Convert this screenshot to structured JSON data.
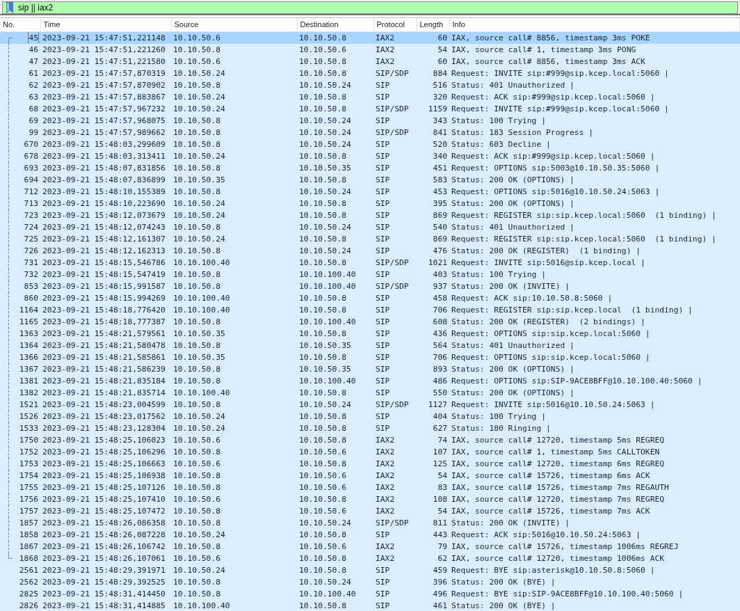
{
  "filter": {
    "value": "sip || iax2"
  },
  "columns": [
    "No.",
    "Time",
    "Source",
    "Destination",
    "Protocol",
    "Length",
    "Info"
  ],
  "rows": [
    {
      "cells": [
        "45",
        "2023-09-21 15:47:51,221148",
        "10.10.50.6",
        "10.10.50.8",
        "IAX2",
        "60",
        "IAX, source call# 8856, timestamp 3ms POKE"
      ],
      "selected": true,
      "kind": "first"
    },
    {
      "cells": [
        "46",
        "2023-09-21 15:47:51,221260",
        "10.10.50.8",
        "10.10.50.6",
        "IAX2",
        "54",
        "IAX, source call# 1, timestamp 3ms PONG"
      ],
      "selected": false,
      "kind": "mid"
    },
    {
      "cells": [
        "47",
        "2023-09-21 15:47:51,221580",
        "10.10.50.6",
        "10.10.50.8",
        "IAX2",
        "60",
        "IAX, source call# 8856, timestamp 3ms ACK"
      ],
      "selected": false,
      "kind": "mid"
    },
    {
      "cells": [
        "61",
        "2023-09-21 15:47:57,870319",
        "10.10.50.24",
        "10.10.50.8",
        "SIP/SDP",
        "884",
        "Request: INVITE sip:#999@sip.kcep.local:5060 |"
      ],
      "selected": false,
      "kind": "mid"
    },
    {
      "cells": [
        "62",
        "2023-09-21 15:47:57,870902",
        "10.10.50.8",
        "10.10.50.24",
        "SIP",
        "516",
        "Status: 401 Unauthorized |"
      ],
      "selected": false,
      "kind": "mid"
    },
    {
      "cells": [
        "63",
        "2023-09-21 15:47:57,883867",
        "10.10.50.24",
        "10.10.50.8",
        "SIP",
        "320",
        "Request: ACK sip:#999@sip.kcep.local:5060 |"
      ],
      "selected": false,
      "kind": "mid"
    },
    {
      "cells": [
        "68",
        "2023-09-21 15:47:57,967232",
        "10.10.50.24",
        "10.10.50.8",
        "SIP/SDP",
        "1159",
        "Request: INVITE sip:#999@sip.kcep.local:5060 |"
      ],
      "selected": false,
      "kind": "mid"
    },
    {
      "cells": [
        "69",
        "2023-09-21 15:47:57,968075",
        "10.10.50.8",
        "10.10.50.24",
        "SIP",
        "343",
        "Status: 100 Trying |"
      ],
      "selected": false,
      "kind": "mid"
    },
    {
      "cells": [
        "99",
        "2023-09-21 15:47:57,989662",
        "10.10.50.8",
        "10.10.50.24",
        "SIP/SDP",
        "841",
        "Status: 183 Session Progress |"
      ],
      "selected": false,
      "kind": "mid"
    },
    {
      "cells": [
        "670",
        "2023-09-21 15:48:03,299609",
        "10.10.50.8",
        "10.10.50.24",
        "SIP",
        "520",
        "Status: 603 Decline |"
      ],
      "selected": false,
      "kind": "mid"
    },
    {
      "cells": [
        "678",
        "2023-09-21 15:48:03,313411",
        "10.10.50.24",
        "10.10.50.8",
        "SIP",
        "340",
        "Request: ACK sip:#999@sip.kcep.local:5060 |"
      ],
      "selected": false,
      "kind": "mid"
    },
    {
      "cells": [
        "693",
        "2023-09-21 15:48:07,831856",
        "10.10.50.8",
        "10.10.50.35",
        "SIP",
        "451",
        "Request: OPTIONS sip:5003@10.10.50.35:5060 |"
      ],
      "selected": false,
      "kind": "mid"
    },
    {
      "cells": [
        "694",
        "2023-09-21 15:48:07,836899",
        "10.10.50.35",
        "10.10.50.8",
        "SIP",
        "583",
        "Status: 200 OK (OPTIONS) |"
      ],
      "selected": false,
      "kind": "mid"
    },
    {
      "cells": [
        "712",
        "2023-09-21 15:48:10,155389",
        "10.10.50.8",
        "10.10.50.24",
        "SIP",
        "453",
        "Request: OPTIONS sip:5016@10.10.50.24:5063 |"
      ],
      "selected": false,
      "kind": "mid"
    },
    {
      "cells": [
        "713",
        "2023-09-21 15:48:10,223690",
        "10.10.50.24",
        "10.10.50.8",
        "SIP",
        "395",
        "Status: 200 OK (OPTIONS) |"
      ],
      "selected": false,
      "kind": "mid"
    },
    {
      "cells": [
        "723",
        "2023-09-21 15:48:12,073679",
        "10.10.50.24",
        "10.10.50.8",
        "SIP",
        "869",
        "Request: REGISTER sip:sip.kcep.local:5060  (1 binding) |"
      ],
      "selected": false,
      "kind": "mid"
    },
    {
      "cells": [
        "724",
        "2023-09-21 15:48:12,074243",
        "10.10.50.8",
        "10.10.50.24",
        "SIP",
        "540",
        "Status: 401 Unauthorized |"
      ],
      "selected": false,
      "kind": "mid"
    },
    {
      "cells": [
        "725",
        "2023-09-21 15:48:12,161307",
        "10.10.50.24",
        "10.10.50.8",
        "SIP",
        "869",
        "Request: REGISTER sip:sip.kcep.local:5060  (1 binding) |"
      ],
      "selected": false,
      "kind": "mid"
    },
    {
      "cells": [
        "726",
        "2023-09-21 15:48:12,162313",
        "10.10.50.8",
        "10.10.50.24",
        "SIP",
        "476",
        "Status: 200 OK (REGISTER)  (1 binding) |"
      ],
      "selected": false,
      "kind": "mid"
    },
    {
      "cells": [
        "731",
        "2023-09-21 15:48:15,546786",
        "10.10.100.40",
        "10.10.50.8",
        "SIP/SDP",
        "1021",
        "Request: INVITE sip:5016@sip.kcep.local |"
      ],
      "selected": false,
      "kind": "mid"
    },
    {
      "cells": [
        "732",
        "2023-09-21 15:48:15,547419",
        "10.10.50.8",
        "10.10.100.40",
        "SIP",
        "403",
        "Status: 100 Trying |"
      ],
      "selected": false,
      "kind": "mid"
    },
    {
      "cells": [
        "853",
        "2023-09-21 15:48:15,991587",
        "10.10.50.8",
        "10.10.100.40",
        "SIP/SDP",
        "937",
        "Status: 200 OK (INVITE) |"
      ],
      "selected": false,
      "kind": "mid"
    },
    {
      "cells": [
        "860",
        "2023-09-21 15:48:15,994269",
        "10.10.100.40",
        "10.10.50.8",
        "SIP",
        "458",
        "Request: ACK sip:10.10.50.8:5060 |"
      ],
      "selected": false,
      "kind": "mid"
    },
    {
      "cells": [
        "1164",
        "2023-09-21 15:48:18,776420",
        "10.10.100.40",
        "10.10.50.8",
        "SIP",
        "706",
        "Request: REGISTER sip:sip.kcep.local  (1 binding) |"
      ],
      "selected": false,
      "kind": "mid"
    },
    {
      "cells": [
        "1165",
        "2023-09-21 15:48:18,777387",
        "10.10.50.8",
        "10.10.100.40",
        "SIP",
        "608",
        "Status: 200 OK (REGISTER)  (2 bindings) |"
      ],
      "selected": false,
      "kind": "mid"
    },
    {
      "cells": [
        "1363",
        "2023-09-21 15:48:21,579561",
        "10.10.50.35",
        "10.10.50.8",
        "SIP",
        "436",
        "Request: OPTIONS sip:sip.kcep.local:5060 |"
      ],
      "selected": false,
      "kind": "mid"
    },
    {
      "cells": [
        "1364",
        "2023-09-21 15:48:21,580478",
        "10.10.50.8",
        "10.10.50.35",
        "SIP",
        "564",
        "Status: 401 Unauthorized |"
      ],
      "selected": false,
      "kind": "mid"
    },
    {
      "cells": [
        "1366",
        "2023-09-21 15:48:21,585861",
        "10.10.50.35",
        "10.10.50.8",
        "SIP",
        "706",
        "Request: OPTIONS sip:sip.kcep.local:5060 |"
      ],
      "selected": false,
      "kind": "mid"
    },
    {
      "cells": [
        "1367",
        "2023-09-21 15:48:21,586239",
        "10.10.50.8",
        "10.10.50.35",
        "SIP",
        "893",
        "Status: 200 OK (OPTIONS) |"
      ],
      "selected": false,
      "kind": "mid"
    },
    {
      "cells": [
        "1381",
        "2023-09-21 15:48:21,835184",
        "10.10.50.8",
        "10.10.100.40",
        "SIP",
        "486",
        "Request: OPTIONS sip:SIP-9ACE8BFF@10.10.100.40:5060 |"
      ],
      "selected": false,
      "kind": "mid"
    },
    {
      "cells": [
        "1382",
        "2023-09-21 15:48:21,835714",
        "10.10.100.40",
        "10.10.50.8",
        "SIP",
        "550",
        "Status: 200 OK (OPTIONS) |"
      ],
      "selected": false,
      "kind": "mid"
    },
    {
      "cells": [
        "1521",
        "2023-09-21 15:48:23,004599",
        "10.10.50.8",
        "10.10.50.24",
        "SIP/SDP",
        "1127",
        "Request: INVITE sip:5016@10.10.50.24:5063 |"
      ],
      "selected": false,
      "kind": "mid"
    },
    {
      "cells": [
        "1526",
        "2023-09-21 15:48:23,017562",
        "10.10.50.24",
        "10.10.50.8",
        "SIP",
        "404",
        "Status: 100 Trying |"
      ],
      "selected": false,
      "kind": "mid"
    },
    {
      "cells": [
        "1533",
        "2023-09-21 15:48:23,128304",
        "10.10.50.24",
        "10.10.50.8",
        "SIP",
        "627",
        "Status: 180 Ringing |"
      ],
      "selected": false,
      "kind": "mid"
    },
    {
      "cells": [
        "1750",
        "2023-09-21 15:48:25,106023",
        "10.10.50.6",
        "10.10.50.8",
        "IAX2",
        "74",
        "IAX, source call# 12720, timestamp 5ms REGREQ"
      ],
      "selected": false,
      "kind": "mid"
    },
    {
      "cells": [
        "1752",
        "2023-09-21 15:48:25,106296",
        "10.10.50.8",
        "10.10.50.6",
        "IAX2",
        "107",
        "IAX, source call# 1, timestamp 5ms CALLTOKEN"
      ],
      "selected": false,
      "kind": "mid"
    },
    {
      "cells": [
        "1753",
        "2023-09-21 15:48:25,106663",
        "10.10.50.6",
        "10.10.50.8",
        "IAX2",
        "125",
        "IAX, source call# 12720, timestamp 6ms REGREQ"
      ],
      "selected": false,
      "kind": "mid"
    },
    {
      "cells": [
        "1754",
        "2023-09-21 15:48:25,106938",
        "10.10.50.8",
        "10.10.50.6",
        "IAX2",
        "54",
        "IAX, source call# 15726, timestamp 6ms ACK"
      ],
      "selected": false,
      "kind": "mid"
    },
    {
      "cells": [
        "1755",
        "2023-09-21 15:48:25,107126",
        "10.10.50.8",
        "10.10.50.6",
        "IAX2",
        "83",
        "IAX, source call# 15726, timestamp 7ms REGAUTH"
      ],
      "selected": false,
      "kind": "mid"
    },
    {
      "cells": [
        "1756",
        "2023-09-21 15:48:25,107410",
        "10.10.50.6",
        "10.10.50.8",
        "IAX2",
        "108",
        "IAX, source call# 12720, timestamp 7ms REGREQ"
      ],
      "selected": false,
      "kind": "mid"
    },
    {
      "cells": [
        "1757",
        "2023-09-21 15:48:25,107472",
        "10.10.50.8",
        "10.10.50.6",
        "IAX2",
        "54",
        "IAX, source call# 15726, timestamp 7ms ACK"
      ],
      "selected": false,
      "kind": "mid"
    },
    {
      "cells": [
        "1857",
        "2023-09-21 15:48:26,086358",
        "10.10.50.8",
        "10.10.50.24",
        "SIP/SDP",
        "811",
        "Status: 200 OK (INVITE) |"
      ],
      "selected": false,
      "kind": "mid"
    },
    {
      "cells": [
        "1858",
        "2023-09-21 15:48:26,087228",
        "10.10.50.24",
        "10.10.50.8",
        "SIP",
        "443",
        "Request: ACK sip:5016@10.10.50.24:5063 |"
      ],
      "selected": false,
      "kind": "mid"
    },
    {
      "cells": [
        "1867",
        "2023-09-21 15:48:26,106742",
        "10.10.50.8",
        "10.10.50.6",
        "IAX2",
        "79",
        "IAX, source call# 15726, timestamp 1006ms REGREJ"
      ],
      "selected": false,
      "kind": "mid"
    },
    {
      "cells": [
        "1868",
        "2023-09-21 15:48:26,107061",
        "10.10.50.6",
        "10.10.50.8",
        "IAX2",
        "62",
        "IAX, source call# 12720, timestamp 1006ms ACK"
      ],
      "selected": false,
      "kind": "last"
    },
    {
      "cells": [
        "2561",
        "2023-09-21 15:48:29,391971",
        "10.10.50.24",
        "10.10.50.8",
        "SIP",
        "459",
        "Request: BYE sip:asterisk@10.10.50.8:5060 |"
      ],
      "selected": false,
      "kind": "plain"
    },
    {
      "cells": [
        "2562",
        "2023-09-21 15:48:29,392525",
        "10.10.50.8",
        "10.10.50.24",
        "SIP",
        "396",
        "Status: 200 OK (BYE) |"
      ],
      "selected": false,
      "kind": "plain"
    },
    {
      "cells": [
        "2825",
        "2023-09-21 15:48:31,414450",
        "10.10.50.8",
        "10.10.100.40",
        "SIP",
        "496",
        "Request: BYE sip:SIP-9ACE8BFF@10.10.100.40:5060 |"
      ],
      "selected": false,
      "kind": "plain"
    },
    {
      "cells": [
        "2826",
        "2023-09-21 15:48:31,414885",
        "10.10.100.40",
        "10.10.50.8",
        "SIP",
        "461",
        "Status: 200 OK (BYE) |"
      ],
      "selected": false,
      "kind": "plain"
    }
  ]
}
